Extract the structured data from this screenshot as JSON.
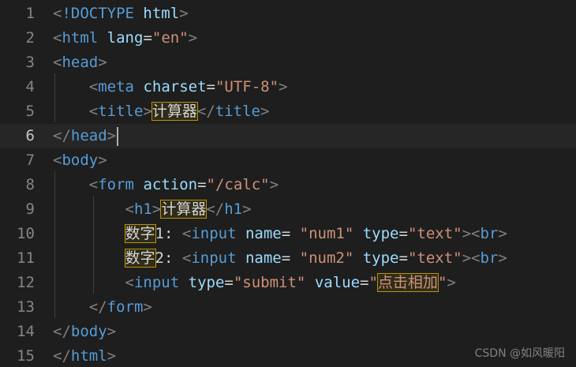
{
  "editor": {
    "current_line": 6,
    "lines": [
      {
        "no": "1",
        "tokens": [
          {
            "t": "<",
            "c": "punc"
          },
          {
            "t": "!DOCTYPE",
            "c": "doctype"
          },
          {
            "t": " ",
            "c": "text"
          },
          {
            "t": "html",
            "c": "attr"
          },
          {
            "t": ">",
            "c": "punc"
          }
        ]
      },
      {
        "no": "2",
        "tokens": [
          {
            "t": "<",
            "c": "punc"
          },
          {
            "t": "html",
            "c": "tag"
          },
          {
            "t": " ",
            "c": "text"
          },
          {
            "t": "lang",
            "c": "attr"
          },
          {
            "t": "=",
            "c": "eq"
          },
          {
            "t": "\"en\"",
            "c": "str"
          },
          {
            "t": ">",
            "c": "punc"
          }
        ]
      },
      {
        "no": "3",
        "tokens": [
          {
            "t": "<",
            "c": "punc"
          },
          {
            "t": "head",
            "c": "tag"
          },
          {
            "t": ">",
            "c": "punc"
          }
        ]
      },
      {
        "no": "4",
        "tokens": [
          {
            "t": "    ",
            "c": "text"
          },
          {
            "t": "<",
            "c": "punc"
          },
          {
            "t": "meta",
            "c": "tag"
          },
          {
            "t": " ",
            "c": "text"
          },
          {
            "t": "charset",
            "c": "attr"
          },
          {
            "t": "=",
            "c": "eq"
          },
          {
            "t": "\"UTF-8\"",
            "c": "str"
          },
          {
            "t": ">",
            "c": "punc"
          }
        ]
      },
      {
        "no": "5",
        "tokens": [
          {
            "t": "    ",
            "c": "text"
          },
          {
            "t": "<",
            "c": "punc"
          },
          {
            "t": "title",
            "c": "tag"
          },
          {
            "t": ">",
            "c": "punc"
          },
          {
            "t": "计算器",
            "c": "hl"
          },
          {
            "t": "</",
            "c": "punc"
          },
          {
            "t": "title",
            "c": "tag"
          },
          {
            "t": ">",
            "c": "punc"
          }
        ]
      },
      {
        "no": "6",
        "tokens": [
          {
            "t": "</",
            "c": "punc"
          },
          {
            "t": "head",
            "c": "tag"
          },
          {
            "t": ">",
            "c": "punc"
          },
          {
            "t": "",
            "c": "cursor"
          }
        ]
      },
      {
        "no": "7",
        "tokens": [
          {
            "t": "<",
            "c": "punc"
          },
          {
            "t": "body",
            "c": "tag"
          },
          {
            "t": ">",
            "c": "punc"
          }
        ]
      },
      {
        "no": "8",
        "tokens": [
          {
            "t": "    ",
            "c": "text"
          },
          {
            "t": "<",
            "c": "punc"
          },
          {
            "t": "form",
            "c": "tag"
          },
          {
            "t": " ",
            "c": "text"
          },
          {
            "t": "action",
            "c": "attr"
          },
          {
            "t": "=",
            "c": "eq"
          },
          {
            "t": "\"/calc\"",
            "c": "str"
          },
          {
            "t": ">",
            "c": "punc"
          }
        ]
      },
      {
        "no": "9",
        "tokens": [
          {
            "t": "        ",
            "c": "text"
          },
          {
            "t": "<",
            "c": "punc"
          },
          {
            "t": "h1",
            "c": "tag"
          },
          {
            "t": ">",
            "c": "punc"
          },
          {
            "t": "计算器",
            "c": "hl"
          },
          {
            "t": "</",
            "c": "punc"
          },
          {
            "t": "h1",
            "c": "tag"
          },
          {
            "t": ">",
            "c": "punc"
          }
        ]
      },
      {
        "no": "10",
        "tokens": [
          {
            "t": "        ",
            "c": "text"
          },
          {
            "t": "数字",
            "c": "hl"
          },
          {
            "t": "1: ",
            "c": "text"
          },
          {
            "t": "<",
            "c": "punc"
          },
          {
            "t": "input",
            "c": "tag"
          },
          {
            "t": " ",
            "c": "text"
          },
          {
            "t": "name",
            "c": "attr"
          },
          {
            "t": "= ",
            "c": "eq"
          },
          {
            "t": "\"num1\"",
            "c": "str"
          },
          {
            "t": " ",
            "c": "text"
          },
          {
            "t": "type",
            "c": "attr"
          },
          {
            "t": "=",
            "c": "eq"
          },
          {
            "t": "\"text\"",
            "c": "str"
          },
          {
            "t": "><",
            "c": "punc"
          },
          {
            "t": "br",
            "c": "tag"
          },
          {
            "t": ">",
            "c": "punc"
          }
        ]
      },
      {
        "no": "11",
        "tokens": [
          {
            "t": "        ",
            "c": "text"
          },
          {
            "t": "数字",
            "c": "hl"
          },
          {
            "t": "2: ",
            "c": "text"
          },
          {
            "t": "<",
            "c": "punc"
          },
          {
            "t": "input",
            "c": "tag"
          },
          {
            "t": " ",
            "c": "text"
          },
          {
            "t": "name",
            "c": "attr"
          },
          {
            "t": "= ",
            "c": "eq"
          },
          {
            "t": "\"num2\"",
            "c": "str"
          },
          {
            "t": " ",
            "c": "text"
          },
          {
            "t": "type",
            "c": "attr"
          },
          {
            "t": "=",
            "c": "eq"
          },
          {
            "t": "\"text\"",
            "c": "str"
          },
          {
            "t": "><",
            "c": "punc"
          },
          {
            "t": "br",
            "c": "tag"
          },
          {
            "t": ">",
            "c": "punc"
          }
        ]
      },
      {
        "no": "12",
        "tokens": [
          {
            "t": "        ",
            "c": "text"
          },
          {
            "t": "<",
            "c": "punc"
          },
          {
            "t": "input",
            "c": "tag"
          },
          {
            "t": " ",
            "c": "text"
          },
          {
            "t": "type",
            "c": "attr"
          },
          {
            "t": "=",
            "c": "eq"
          },
          {
            "t": "\"submit\"",
            "c": "str"
          },
          {
            "t": " ",
            "c": "text"
          },
          {
            "t": "value",
            "c": "attr"
          },
          {
            "t": "=",
            "c": "eq"
          },
          {
            "t": "\"",
            "c": "str"
          },
          {
            "t": "点击相加",
            "c": "hl-str"
          },
          {
            "t": "\"",
            "c": "str"
          },
          {
            "t": ">",
            "c": "punc"
          }
        ]
      },
      {
        "no": "13",
        "tokens": [
          {
            "t": "    ",
            "c": "text"
          },
          {
            "t": "</",
            "c": "punc"
          },
          {
            "t": "form",
            "c": "tag"
          },
          {
            "t": ">",
            "c": "punc"
          }
        ]
      },
      {
        "no": "14",
        "tokens": [
          {
            "t": "</",
            "c": "punc"
          },
          {
            "t": "body",
            "c": "tag"
          },
          {
            "t": ">",
            "c": "punc"
          }
        ]
      },
      {
        "no": "15",
        "tokens": [
          {
            "t": "</",
            "c": "punc"
          },
          {
            "t": "html",
            "c": "tag"
          },
          {
            "t": ">",
            "c": "punc"
          }
        ]
      }
    ]
  },
  "watermark": "CSDN @如风暖阳",
  "colors": {
    "background": "#1e1e1e",
    "tag": "#569cd6",
    "attribute": "#9cdcfe",
    "string": "#ce9178",
    "punctuation": "#808080",
    "highlight_border": "#b89500"
  }
}
